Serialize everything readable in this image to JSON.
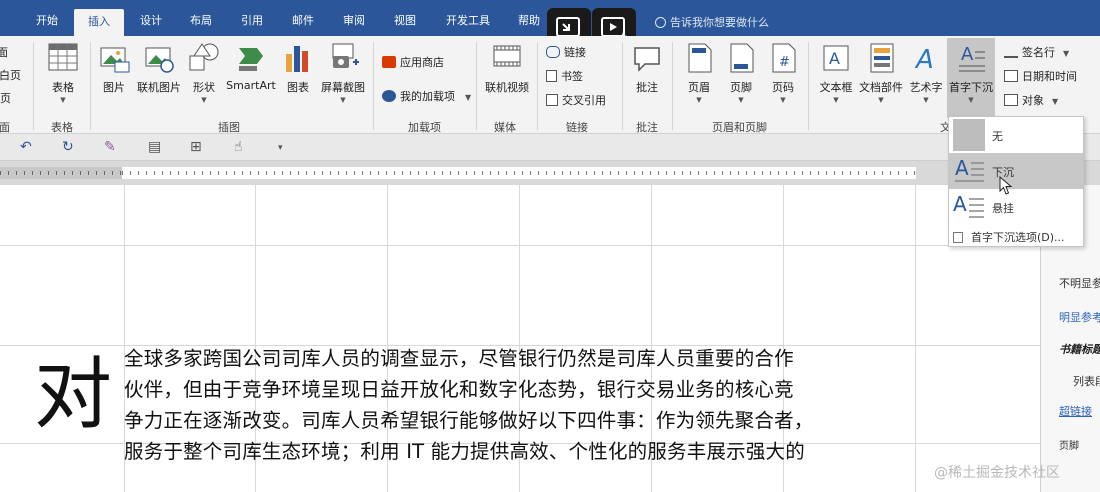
{
  "tabs": [
    {
      "label": "开始",
      "active": false
    },
    {
      "label": "插入",
      "active": true
    },
    {
      "label": "设计",
      "active": false
    },
    {
      "label": "布局",
      "active": false
    },
    {
      "label": "引用",
      "active": false
    },
    {
      "label": "邮件",
      "active": false
    },
    {
      "label": "审阅",
      "active": false
    },
    {
      "label": "视图",
      "active": false
    },
    {
      "label": "开发工具",
      "active": false
    },
    {
      "label": "帮助",
      "active": false
    }
  ],
  "tell_me": "告诉我你想要做什么",
  "ribbon": {
    "pages_group": {
      "items": [
        "封面",
        "空白页",
        "分页"
      ],
      "label": "页面"
    },
    "tables_group": {
      "table": "表格",
      "label": "表格"
    },
    "illustrations_group": {
      "picture": "图片",
      "online_picture": "联机图片",
      "shapes": "形状",
      "smartart": "SmartArt",
      "chart": "图表",
      "screenshot": "屏幕截图",
      "label": "插图"
    },
    "addins_group": {
      "store": "应用商店",
      "my_addins": "我的加载项",
      "label": "加载项"
    },
    "media_group": {
      "online_video": "联机视频",
      "label": "媒体"
    },
    "links_group": {
      "link": "链接",
      "bookmark": "书签",
      "cross_ref": "交叉引用",
      "label": "链接"
    },
    "comments_group": {
      "comment": "批注",
      "label": "批注"
    },
    "header_footer_group": {
      "header": "页眉",
      "footer": "页脚",
      "page_number": "页码",
      "label": "页眉和页脚"
    },
    "text_group": {
      "textbox": "文本框",
      "quick_parts": "文档部件",
      "wordart": "艺术字",
      "dropcap": "首字下沉",
      "signature": "签名行",
      "datetime": "日期和时间",
      "object": "对象",
      "label": "文"
    }
  },
  "dropcap_menu": {
    "items": [
      {
        "label": "无",
        "hover": false
      },
      {
        "label": "下沉",
        "hover": true
      },
      {
        "label": "悬挂",
        "hover": false
      }
    ],
    "options": "首字下沉选项(D)..."
  },
  "document": {
    "dropcap_char": "对",
    "lines": [
      "全球多家跨国公司司库人员的调查显示，尽管银行仍然是司库人员重要的合作",
      "伙伴，但由于竞争环境呈现日益开放化和数字化态势，银行交易业务的核心竞",
      "争力正在逐渐改变。司库人员希望银行能够做好以下四件事：作为领先聚合者，",
      "服务于整个司库生态环境；利用 IT 能力提供高效、个性化的服务丰展示强大的"
    ]
  },
  "styles_pane": [
    "不明显参考",
    "明显参考",
    "书籍标题",
    "列表段落",
    "超链接",
    "页脚"
  ],
  "watermark": "@稀土掘金技术社区",
  "colors": {
    "accent": "#2b579a",
    "link": "#2b64b8"
  }
}
